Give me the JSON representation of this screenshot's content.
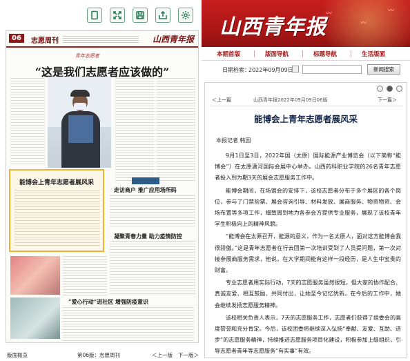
{
  "viewer": {
    "toolbar_icons": [
      "page-icon",
      "fullscreen-icon",
      "save-icon",
      "share-icon",
      "settings-icon"
    ]
  },
  "paper": {
    "page_number": "06",
    "section": "志愿周刊",
    "logo": "山西青年报",
    "kicker": "青年志愿者",
    "headline": "“这是我们志愿者应该做的”",
    "highlight_title": "能博会上青年志愿者展风采",
    "sub_heading_1": "走访商户  推广应用场所码",
    "sub_heading_2": "凝聚青春力量  助力疫情防控",
    "sub_heading_3": "“爱心行动”进社区  增强防疫意识"
  },
  "left_footer": {
    "prev_page": "版面概览",
    "current": "第06版：志愿周刊",
    "prev": "＜上一版",
    "next": "下一版＞"
  },
  "site": {
    "brand": "山西青年报",
    "nav": [
      "本期首版",
      "版面导航",
      "标题导航",
      "生活版面"
    ],
    "date_label": "日期检索：",
    "date_value": "2022年09月09日",
    "search_placeholder": "",
    "search_button": "新闻搜索"
  },
  "article": {
    "prev": "＜上一篇",
    "meta": "山西青年报2022年09月09日06版",
    "next": "下一篇＞",
    "title": "能博会上青年志愿者展风采",
    "author": "本报记者  韩园",
    "paragraphs": [
      "9月1日至3日，2022年国（太原）国际能源产业博览会（以下简称“能博会”）在太原潇河国际会展中心举办。山西药科职业学院的26名青年志愿者投入到为期3天的展会志愿服务工作中。",
      "能博会期间，在场馆会的安排下，该校志愿者分布于多个展区的各个岗位，参与了门禁验票、展会咨询引导、材料发放、展商服务、物资物资、会场布置等多项工作，细致周到地为各参会方提供专业服务，展现了该校青年学生积极向上的精神风貌。",
      "“能博会在太原召开，能源的意义，作为一名太原人，面对这方能博会我很骄傲。”这是青年志愿者在行云团第一次培训受到了人员提问题，第一次对接参展商服务需求，他说，在大学期间能有这样一段经历，是人生中宝贵的财富。",
      "专业志愿者用实际行动，7天的志愿服务虽然很短，但大家的协作配合、真诚友爱、相互鼓励、共同付出，让她至今记忆犹新。在今后的工作中，她会继续发扬志愿服务精神。",
      "该校相关负责人表示，7天的志愿服务工作，志愿者们获得了组委会的高度赞誉和充分肯定。今后，该校团委将继续深入弘扬“奉献、友爱、互助、进步”的志愿服务精神，持续推进志愿服务项目化建设，积极参加上级组织，引导志愿者青年等志愿服务“有实事”有效。"
    ]
  }
}
